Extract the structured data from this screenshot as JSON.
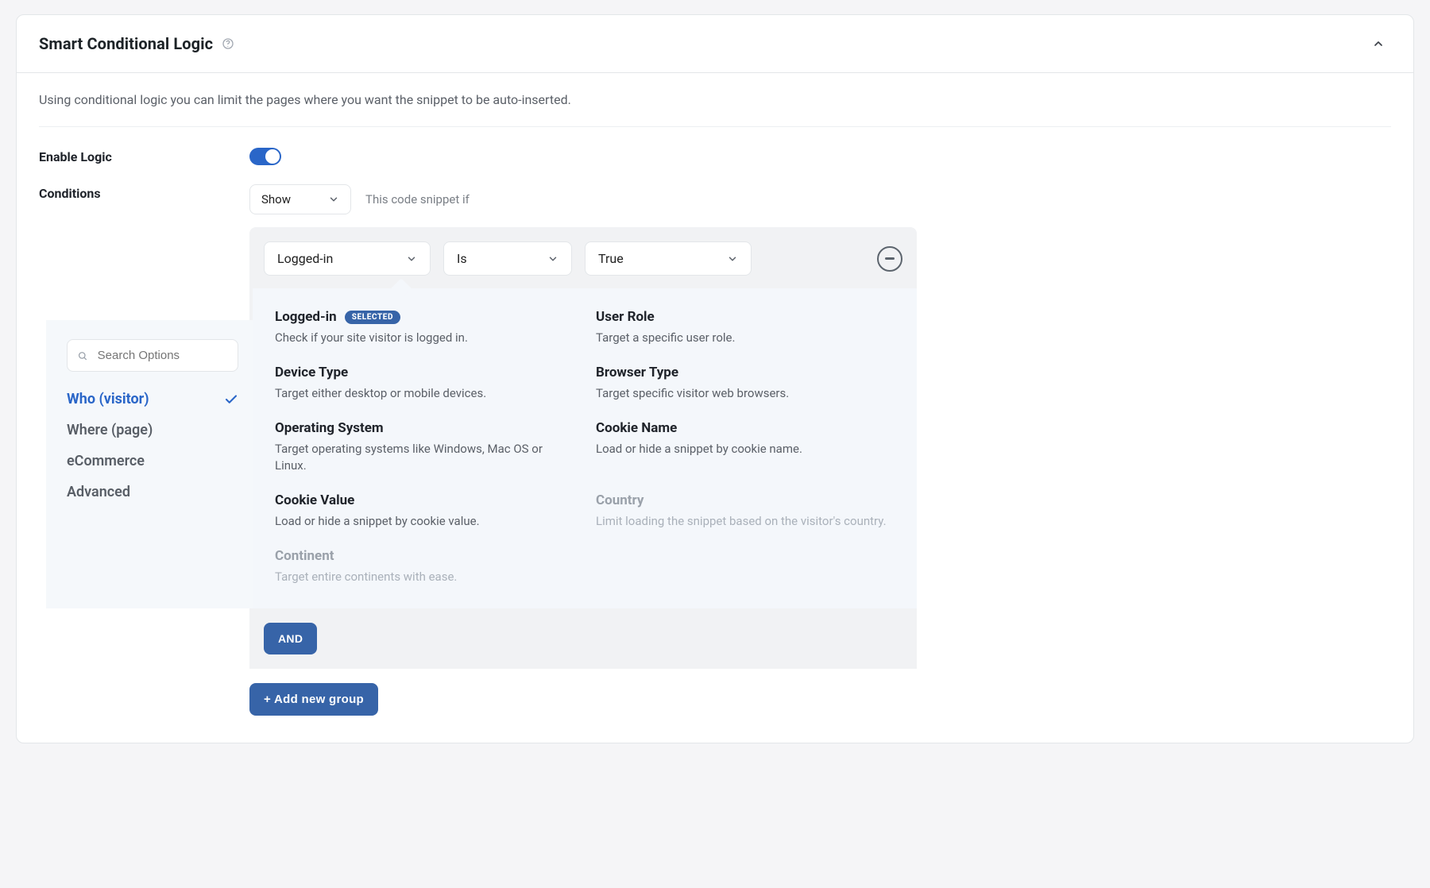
{
  "header": {
    "title": "Smart Conditional Logic"
  },
  "description": "Using conditional logic you can limit the pages where you want the snippet to be auto-inserted.",
  "rows": {
    "enable_label": "Enable Logic",
    "conditions_label": "Conditions"
  },
  "conditions": {
    "mode": "Show",
    "sentence": "This code snippet if"
  },
  "rule": {
    "field": "Logged-in",
    "operator": "Is",
    "value": "True"
  },
  "sidebar": {
    "search_placeholder": "Search Options",
    "tabs": [
      {
        "key": "who",
        "label": "Who (visitor)",
        "active": true
      },
      {
        "key": "where",
        "label": "Where (page)",
        "active": false
      },
      {
        "key": "ecommerce",
        "label": "eCommerce",
        "active": false
      },
      {
        "key": "advanced",
        "label": "Advanced",
        "active": false
      }
    ]
  },
  "options": {
    "selected_badge": "SELECTED",
    "items": [
      {
        "title": "Logged-in",
        "desc": "Check if your site visitor is logged in.",
        "selected": true,
        "disabled": false
      },
      {
        "title": "User Role",
        "desc": "Target a specific user role.",
        "selected": false,
        "disabled": false
      },
      {
        "title": "Device Type",
        "desc": "Target either desktop or mobile devices.",
        "selected": false,
        "disabled": false
      },
      {
        "title": "Browser Type",
        "desc": "Target specific visitor web browsers.",
        "selected": false,
        "disabled": false
      },
      {
        "title": "Operating System",
        "desc": "Target operating systems like Windows, Mac OS or Linux.",
        "selected": false,
        "disabled": false
      },
      {
        "title": "Cookie Name",
        "desc": "Load or hide a snippet by cookie name.",
        "selected": false,
        "disabled": false
      },
      {
        "title": "Cookie Value",
        "desc": "Load or hide a snippet by cookie value.",
        "selected": false,
        "disabled": false
      },
      {
        "title": "Country",
        "desc": "Limit loading the snippet based on the visitor's country.",
        "selected": false,
        "disabled": true
      },
      {
        "title": "Continent",
        "desc": "Target entire continents with ease.",
        "selected": false,
        "disabled": true
      }
    ]
  },
  "and_label": "AND",
  "add_group_label": "+ Add new group"
}
